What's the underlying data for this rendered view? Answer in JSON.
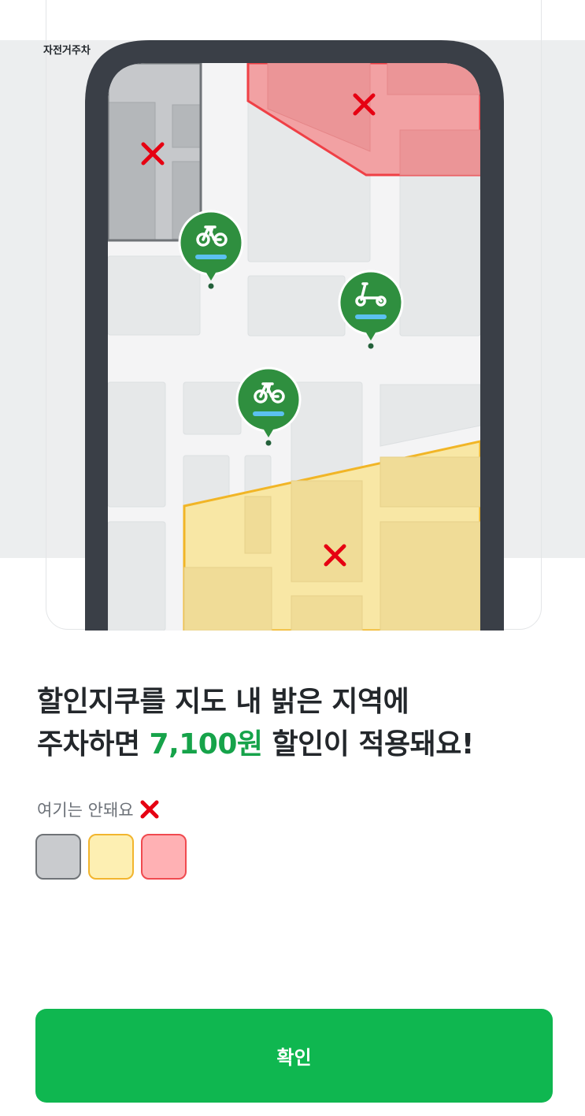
{
  "tag_label": "자전거주차",
  "headline": {
    "line1": "할인지쿠를 지도 내 밝은 지역에",
    "line2_prefix": "주차하면 ",
    "line2_amount": "7,100원",
    "line2_suffix": " 할인이 적용돼요!"
  },
  "restricted_label": "여기는 안돼요",
  "zone_swatches": [
    {
      "name": "grey-zone",
      "fill": "#c9cbce",
      "border": "#6f7377"
    },
    {
      "name": "yellow-zone",
      "fill": "#fdefb2",
      "border": "#f2b52e"
    },
    {
      "name": "red-zone",
      "fill": "#ffb1b4",
      "border": "#f04a4f"
    }
  ],
  "colors": {
    "accent_green": "#16a34a",
    "button_green": "#0fb750",
    "marker_green": "#2f8f3f",
    "x_red": "#e60012"
  },
  "confirm_label": "확인"
}
